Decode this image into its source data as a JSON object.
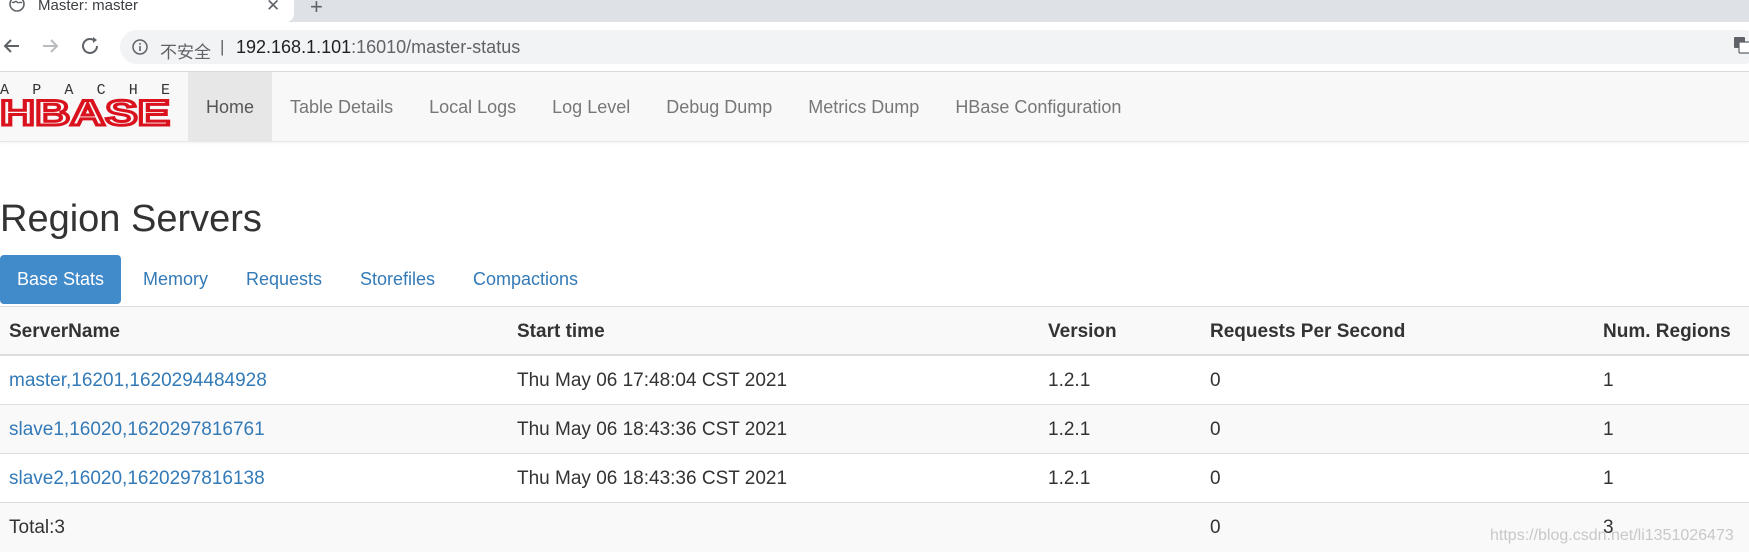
{
  "browser": {
    "tab_title": "Master: master",
    "security_label": "不安全",
    "separator": "|",
    "url_host": "192.168.1.101",
    "url_rest": ":16010/master-status"
  },
  "navbar": {
    "logo_top_text": "APACHE",
    "logo_text": "HBASE",
    "items": [
      {
        "label": "Home",
        "active": true
      },
      {
        "label": "Table Details"
      },
      {
        "label": "Local Logs"
      },
      {
        "label": "Log Level"
      },
      {
        "label": "Debug Dump"
      },
      {
        "label": "Metrics Dump"
      },
      {
        "label": "HBase Configuration"
      }
    ]
  },
  "section": {
    "title": "Region Servers",
    "tabs": [
      {
        "label": "Base Stats",
        "active": true
      },
      {
        "label": "Memory"
      },
      {
        "label": "Requests"
      },
      {
        "label": "Storefiles"
      },
      {
        "label": "Compactions"
      }
    ]
  },
  "table": {
    "headers": [
      "ServerName",
      "Start time",
      "Version",
      "Requests Per Second",
      "Num. Regions"
    ],
    "rows": [
      [
        "master,16201,1620294484928",
        "Thu May 06 17:48:04 CST 2021",
        "1.2.1",
        "0",
        "1"
      ],
      [
        "slave1,16020,1620297816761",
        "Thu May 06 18:43:36 CST 2021",
        "1.2.1",
        "0",
        "1"
      ],
      [
        "slave2,16020,1620297816138",
        "Thu May 06 18:43:36 CST 2021",
        "1.2.1",
        "0",
        "1"
      ]
    ],
    "total": {
      "label": "Total:3",
      "requests": "0",
      "regions": "3"
    }
  },
  "watermark": "https://blog.csdn.net/li1351026473",
  "colors": {
    "link": "#337ab7",
    "active_tab": "#428bca",
    "logo_red": "#d9121e"
  }
}
